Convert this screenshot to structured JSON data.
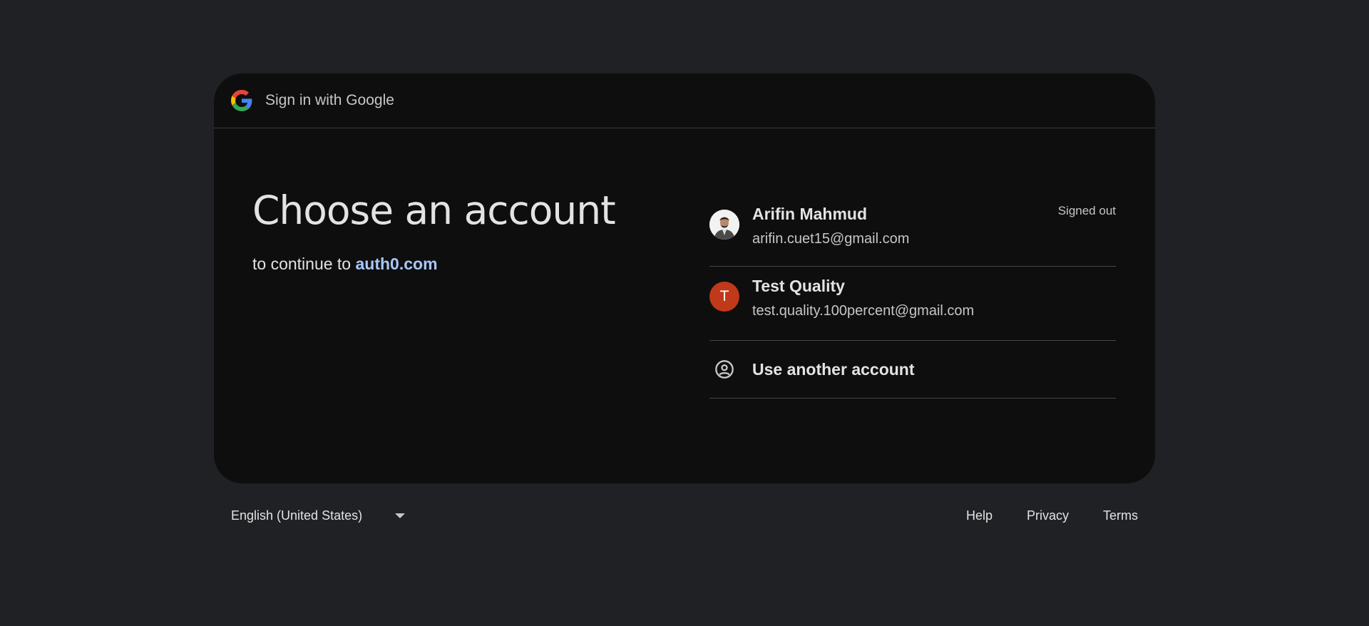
{
  "header": {
    "title": "Sign in with Google",
    "logo_icon": "google-g-icon"
  },
  "main": {
    "title": "Choose an account",
    "subtitle_prefix": "to continue to",
    "subtitle_link": "auth0.com"
  },
  "accounts": [
    {
      "name": "Arifin Mahmud",
      "email": "arifin.cuet15@gmail.com",
      "status": "Signed out",
      "avatar": "profile-photo"
    },
    {
      "name": "Test Quality",
      "email": "test.quality.100percent@gmail.com",
      "avatar_letter": "T",
      "avatar_color": "#c0391a"
    }
  ],
  "use_another": {
    "label": "Use another account",
    "icon": "account-circle-icon"
  },
  "footer": {
    "language": "English (United States)",
    "links": [
      "Help",
      "Privacy",
      "Terms"
    ]
  },
  "colors": {
    "background": "#202124",
    "card": "#0e0e0e",
    "link": "#a8c7fa"
  }
}
